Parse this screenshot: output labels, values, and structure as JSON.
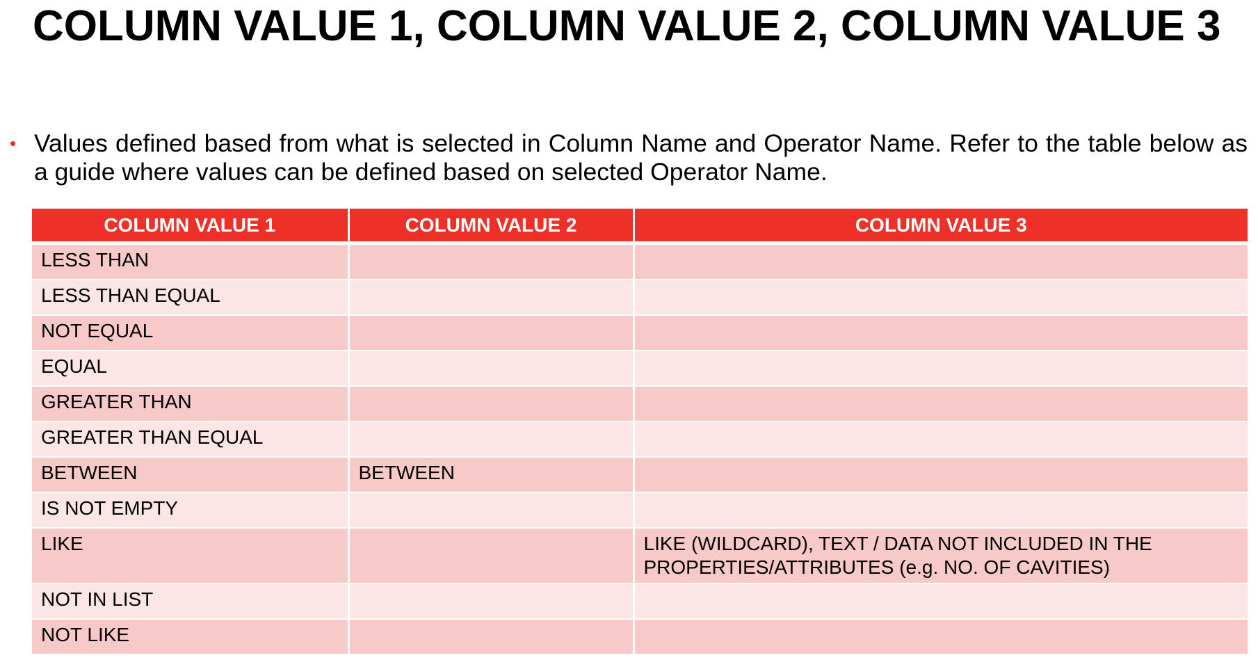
{
  "title": "COLUMN VALUE 1, COLUMN VALUE 2, COLUMN VALUE 3",
  "bullet": {
    "symbol": "•",
    "text": "Values defined based from what is selected in Column Name and Operator Name. Refer to the table below as a guide where values can be defined based on selected Operator Name."
  },
  "table": {
    "headers": [
      "COLUMN VALUE 1",
      "COLUMN VALUE 2",
      "COLUMN VALUE 3"
    ],
    "rows": [
      [
        "LESS THAN",
        "",
        ""
      ],
      [
        "LESS THAN EQUAL",
        "",
        ""
      ],
      [
        "NOT EQUAL",
        "",
        ""
      ],
      [
        "EQUAL",
        "",
        ""
      ],
      [
        "GREATER THAN",
        "",
        ""
      ],
      [
        "GREATER THAN EQUAL",
        "",
        ""
      ],
      [
        "BETWEEN",
        "BETWEEN",
        ""
      ],
      [
        "IS NOT EMPTY",
        "",
        ""
      ],
      [
        "LIKE",
        "",
        "LIKE (WILDCARD), TEXT / DATA NOT INCLUDED IN THE PROPERTIES/ATTRIBUTES (e.g. NO. OF CAVITIES)"
      ],
      [
        "NOT IN LIST",
        "",
        ""
      ],
      [
        "NOT LIKE",
        "",
        ""
      ]
    ]
  },
  "colors": {
    "header_bg": "#ee3128",
    "row_dark": "#f7c9c9",
    "row_light": "#fbe5e5",
    "bullet": "#e8302a"
  }
}
